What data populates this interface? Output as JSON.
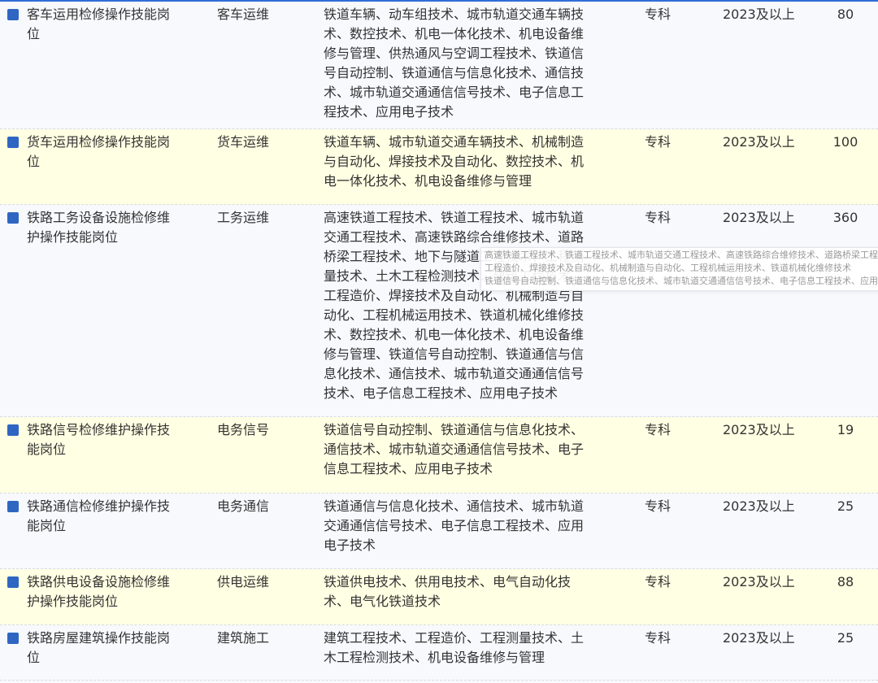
{
  "rows": [
    {
      "name": "客车运用检修操作技能岗位",
      "major": "客车运维",
      "specialties": "铁道车辆、动车组技术、城市轨道交通车辆技术、数控技术、机电一体化技术、机电设备维修与管理、供热通风与空调工程技术、铁道信号自动控制、铁道通信与信息化技术、通信技术、城市轨道交通通信信号技术、电子信息工程技术、应用电子技术",
      "education": "专科",
      "year": "2023及以上",
      "count": "80"
    },
    {
      "name": "货车运用检修操作技能岗位",
      "major": "货车运维",
      "specialties": "铁道车辆、城市轨道交通车辆技术、机械制造与自动化、焊接技术及自动化、数控技术、机电一体化技术、机电设备维修与管理",
      "education": "专科",
      "year": "2023及以上",
      "count": "100"
    },
    {
      "name": "铁路工务设备设施检修维护操作技能岗位",
      "major": "工务运维",
      "specialties": "高速铁道工程技术、铁道工程技术、城市轨道交通工程技术、高速铁路综合维修技术、道路桥梁工程技术、地下与隧道工程技术、工程测量技术、土木工程检测技术、建筑工程技术、工程造价、焊接技术及自动化、机械制造与自动化、工程机械运用技术、铁道机械化维修技术、数控技术、机电一体化技术、机电设备维修与管理、铁道信号自动控制、铁道通信与信息化技术、通信技术、城市轨道交通通信信号技术、电子信息工程技术、应用电子技术",
      "education": "专科",
      "year": "2023及以上",
      "count": "360"
    },
    {
      "name": "铁路信号检修维护操作技能岗位",
      "major": "电务信号",
      "specialties": "铁道信号自动控制、铁道通信与信息化技术、通信技术、城市轨道交通通信信号技术、电子信息工程技术、应用电子技术",
      "education": "专科",
      "year": "2023及以上",
      "count": "19"
    },
    {
      "name": "铁路通信检修维护操作技能岗位",
      "major": "电务通信",
      "specialties": "铁道通信与信息化技术、通信技术、城市轨道交通通信信号技术、电子信息工程技术、应用电子技术",
      "education": "专科",
      "year": "2023及以上",
      "count": "25"
    },
    {
      "name": "铁路供电设备设施检修维护操作技能岗位",
      "major": "供电运维",
      "specialties": "铁道供电技术、供用电技术、电气自动化技术、电气化铁道技术",
      "education": "专科",
      "year": "2023及以上",
      "count": "88"
    },
    {
      "name": "铁路房屋建筑操作技能岗位",
      "major": "建筑施工",
      "specialties": "建筑工程技术、工程造价、工程测量技术、土木工程检测技术、机电设备维修与管理",
      "education": "专科",
      "year": "2023及以上",
      "count": "25"
    }
  ],
  "tooltip": {
    "lines": [
      "高速铁道工程技术、铁道工程技术、城市轨道交通工程技术、高速铁路综合维修技术、道路桥梁工程技术",
      "工程造价、焊接技术及自动化、机械制造与自动化、工程机械运用技术、铁道机械化维修技术",
      "铁道信号自动控制、铁道通信与信息化技术、城市轨道交通通信信号技术、电子信息工程技术、应用电子技术"
    ]
  },
  "colors": {
    "accent": "#2e66c2",
    "row_alt": "#ffffe3",
    "row_plain": "#f7f9fd"
  }
}
